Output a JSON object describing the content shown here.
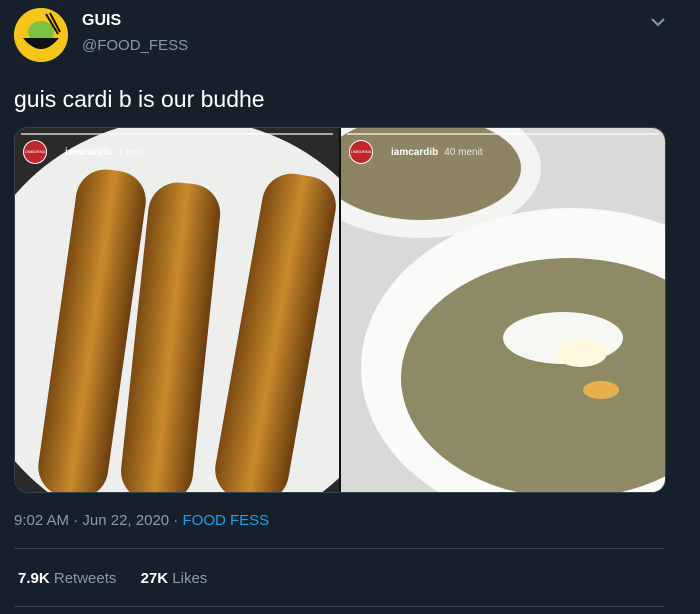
{
  "author": {
    "name": "GUIS",
    "handle": "@FOOD_FESS",
    "avatar_label": "FOOD FESS"
  },
  "tweet": {
    "text": "guis cardi b is our budhe"
  },
  "media": {
    "left": {
      "user": "iamcardib",
      "time": "1 jam",
      "avatar_label": "OMBORNA 700 LAW"
    },
    "right": {
      "user": "iamcardib",
      "time": "40 menit",
      "avatar_label": "OMBORNA 700 LAW"
    }
  },
  "meta": {
    "time": "9:02 AM",
    "separator1": " · ",
    "date": "Jun 22, 2020",
    "separator2": " · ",
    "source": "FOOD FESS"
  },
  "stats": {
    "retweets_count": "7.9K",
    "retweets_label": "Retweets",
    "likes_count": "27K",
    "likes_label": "Likes"
  },
  "colors": {
    "background": "#15202b",
    "accent": "#1da1f2",
    "muted": "#8899a6",
    "border": "#38444d"
  },
  "icons": {
    "caret": "chevron-down-icon"
  }
}
